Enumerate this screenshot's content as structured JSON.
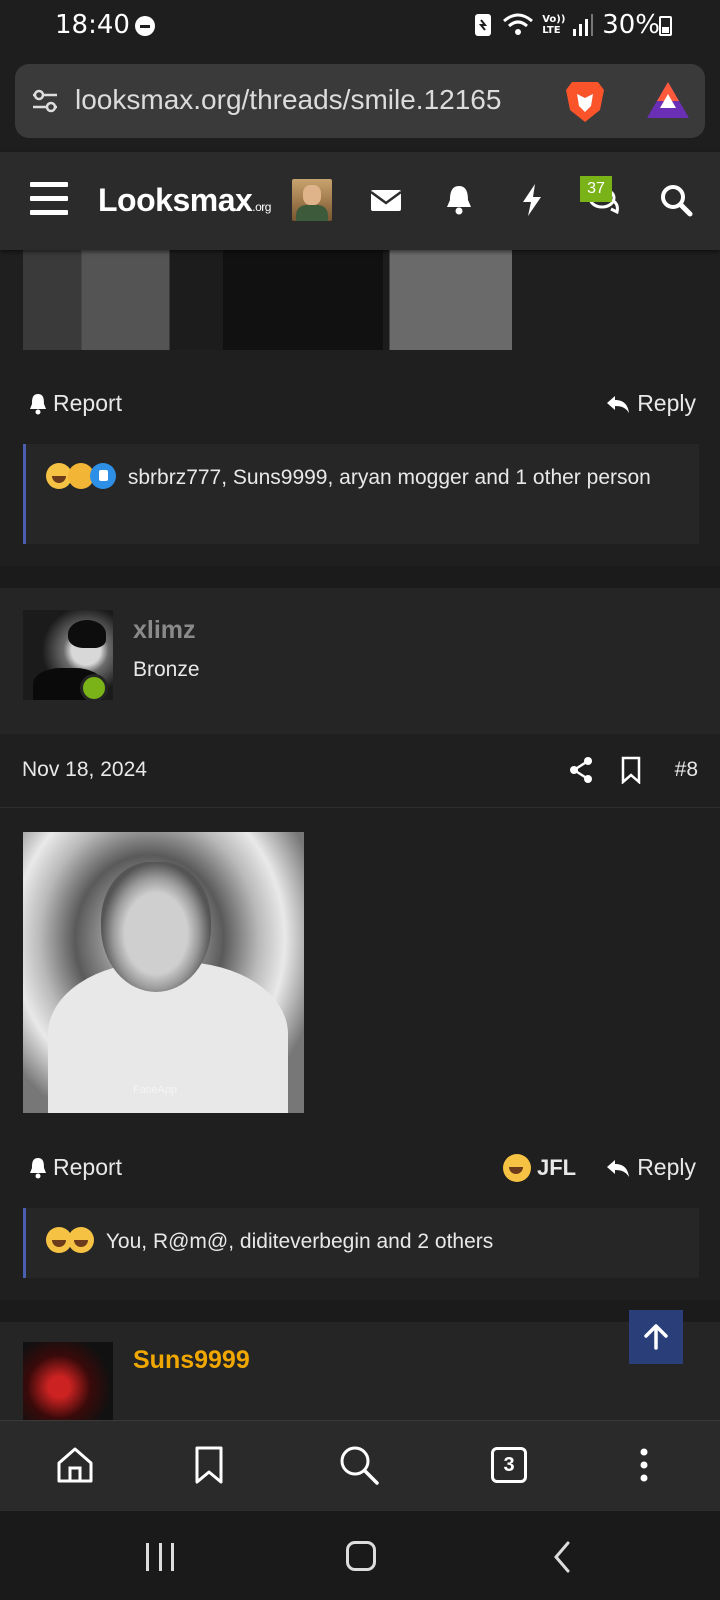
{
  "status_bar": {
    "time": "18:40",
    "network_label": "Vo)) LTE",
    "battery": "30%"
  },
  "browser": {
    "url": "looksmax.org/threads/smile.12165",
    "tab_count": "3"
  },
  "site": {
    "logo": "Looksmax",
    "logo_suffix": ".org",
    "conversations_badge": "37"
  },
  "posts": {
    "prev": {
      "report_label": "Report",
      "reply_label": "Reply",
      "reactions_text": "sbrbrz777, Suns9999, aryan mogger and 1 other person"
    },
    "current": {
      "username": "xlimz",
      "user_title": "Bronze",
      "date": "Nov 18, 2024",
      "post_number": "#8",
      "image_watermark": "FaceApp",
      "report_label": "Report",
      "reaction_label": "JFL",
      "reply_label": "Reply",
      "reactions_text": "You, R@m@, diditeverbegin and 2 others"
    },
    "next": {
      "username": "Suns9999"
    }
  },
  "colors": {
    "background": "#1f1f1f",
    "accent_green": "#7ab317",
    "username_next": "#f0a800",
    "username_current": "#8a8a8a",
    "scrolltop": "#2a3f7a"
  },
  "icons": [
    "tune-icon",
    "brave-lion-icon",
    "brave-rewards-icon",
    "menu-icon",
    "mail-icon",
    "bell-icon",
    "bolt-icon",
    "chat-icon",
    "search-icon",
    "share-icon",
    "bookmark-icon",
    "reply-arrow-icon",
    "home-icon",
    "arrow-up-icon",
    "more-icon"
  ]
}
